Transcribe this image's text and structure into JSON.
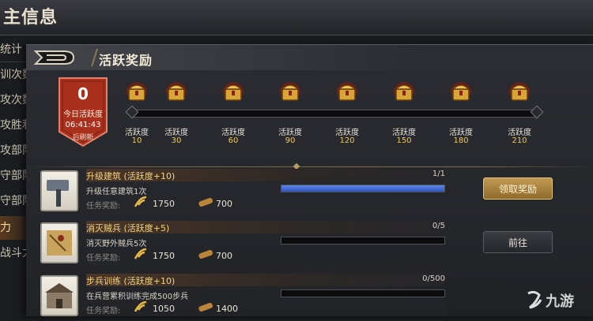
{
  "background": {
    "title": "主信息"
  },
  "left_menu": {
    "items": [
      {
        "label": "统计"
      },
      {
        "label": "训次数"
      },
      {
        "label": "攻次数"
      },
      {
        "label": "攻胜利"
      },
      {
        "label": "攻部队"
      },
      {
        "label": "守部队"
      },
      {
        "label": "守部队"
      },
      {
        "label": "力"
      },
      {
        "label": "战斗力"
      }
    ]
  },
  "panel": {
    "title": "活跃奖励"
  },
  "badge": {
    "value": "0",
    "label": "今日活跃度",
    "countdown": "06:41:43",
    "refresh": "后刷新"
  },
  "milestones": [
    {
      "label": "活跃度",
      "value": "10"
    },
    {
      "label": "活跃度",
      "value": "30"
    },
    {
      "label": "活跃度",
      "value": "60"
    },
    {
      "label": "活跃度",
      "value": "90"
    },
    {
      "label": "活跃度",
      "value": "120"
    },
    {
      "label": "活跃度",
      "value": "150"
    },
    {
      "label": "活跃度",
      "value": "180"
    },
    {
      "label": "活跃度",
      "value": "210"
    }
  ],
  "tasks": [
    {
      "title": "升级建筑 (活跃度+10)",
      "count": "1/1",
      "desc": "升级任意建筑1次",
      "reward_label": "任务奖励:",
      "reward_food": "1750",
      "reward_wood": "700",
      "progress": 1.0,
      "icon": "hammer-icon"
    },
    {
      "title": "消灭贼兵 (活跃度+5)",
      "count": "0/5",
      "desc": "消灭野外贼兵5次",
      "reward_label": "任务奖励:",
      "reward_food": "1750",
      "reward_wood": "700",
      "progress": 0,
      "icon": "map-scroll-icon"
    },
    {
      "title": "步兵训练 (活跃度+10)",
      "count": "0/500",
      "desc": "在兵营累积训练完成500步兵",
      "reward_label": "任务奖励:",
      "reward_food": "1050",
      "reward_wood": "1400",
      "progress": 0,
      "icon": "barracks-icon"
    }
  ],
  "buttons": {
    "claim": "领取奖励",
    "go": "前往"
  },
  "watermark": {
    "text": "九游"
  },
  "colors": {
    "accent_gold": "#f0c94e",
    "progress_blue": "#3a62cc",
    "badge_red": "#b8321e"
  }
}
